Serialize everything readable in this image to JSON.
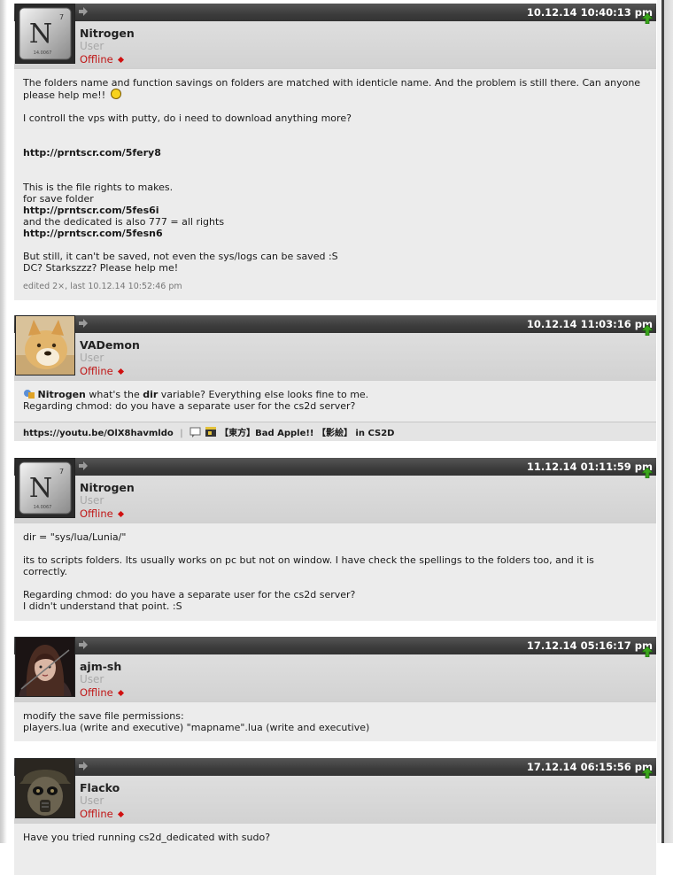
{
  "posts": [
    {
      "username": "Nitrogen",
      "rank": "User",
      "status": "Offline",
      "date": "10.12.14 10:40:13 pm",
      "avatar": "nitrogen-element-tile",
      "body": {
        "line1": "The folders name and function savings on folders are matched with identicle name. And the problem is still there. Can anyone",
        "line2": "please help me!!",
        "line3": "I controll the vps with putty, do i need to download anything more?",
        "link1": "http://prntscr.com/5fery8",
        "line4": "This is the file rights to makes.",
        "line5": "for save folder",
        "link2": "http://prntscr.com/5fes6i",
        "line6": "and the dedicated is also 777 = all rights",
        "link3": "http://prntscr.com/5fesn6",
        "line7": "But still, it can't be saved, not even the sys/logs can be saved :S",
        "line8": "DC? Starkszzz? Please help me!"
      },
      "edited": "edited 2×, last 10.12.14 10:52:46 pm"
    },
    {
      "username": "VADemon",
      "rank": "User",
      "status": "Offline",
      "date": "10.12.14 11:03:16 pm",
      "avatar": "doge-avatar",
      "body": {
        "quote_user": "Nitrogen",
        "line1_a": " what's the ",
        "line1_b": "dir",
        "line1_c": " variable? Everything else looks fine to me.",
        "line2": "Regarding chmod: do you have a separate user for the cs2d server?"
      },
      "signature": {
        "link": "https://youtu.be/OlX8havmldo",
        "song": "【東方】Bad Apple!! 【影絵】 in CS2D"
      }
    },
    {
      "username": "Nitrogen",
      "rank": "User",
      "status": "Offline",
      "date": "11.12.14 01:11:59 pm",
      "avatar": "nitrogen-element-tile",
      "body": {
        "line1": "dir = \"sys/lua/Lunia/\"",
        "line2": "its to scripts folders. Its usually works on pc but not on window. I have check the spellings to the folders too, and it is",
        "line3": "correctly.",
        "line4": "Regarding chmod: do you have a separate user for the cs2d server?",
        "line5": "I didn't understand that point. :S"
      }
    },
    {
      "username": "ajm-sh",
      "rank": "User",
      "status": "Offline",
      "date": "17.12.14 05:16:17 pm",
      "avatar": "dark-hooded-girl",
      "body": {
        "line1": "modify the save file permissions:",
        "line2": "players.lua (write and executive) \"mapname\".lua (write and executive)"
      }
    },
    {
      "username": "Flacko",
      "rank": "User",
      "status": "Offline",
      "date": "17.12.14 06:15:56 pm",
      "avatar": "gasmask-soldier",
      "body": {
        "line1": "Have you tried running cs2d_dedicated with sudo?"
      }
    }
  ],
  "element_tile": {
    "symbol": "N",
    "number": "7",
    "mass": "14.0067"
  },
  "colors": {
    "header_bg": "#3c3c3c",
    "header_text": "#ffffff",
    "bar_bg": "#d8d8d8",
    "body_bg": "#ececec",
    "offline_red": "#c01818",
    "rank_grey": "#a8a8a8",
    "up_arrow_green": "#3aa51b"
  }
}
